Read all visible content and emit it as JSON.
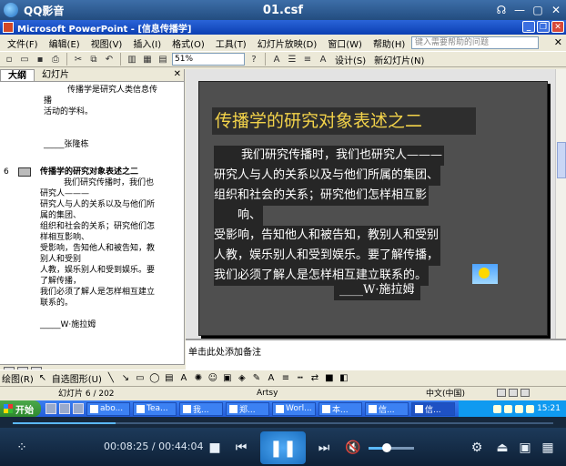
{
  "player": {
    "app_name": "QQ影音",
    "file_name": "01.csf",
    "win_buttons": [
      "☊",
      "—",
      "▢",
      "✕"
    ],
    "time_current": "00:08:25",
    "time_total": "00:44:04",
    "progress_fraction": 0.191,
    "volume_fraction": 0.4
  },
  "ppt": {
    "title": "Microsoft PowerPoint - [信息传播学]",
    "menu": [
      "文件(F)",
      "编辑(E)",
      "视图(V)",
      "插入(I)",
      "格式(O)",
      "工具(T)",
      "幻灯片放映(D)",
      "窗口(W)",
      "帮助(H)"
    ],
    "help_placeholder": "键入需要帮助的问题",
    "zoom": "51%",
    "design_label": "设计(S)",
    "new_slide_label": "新幻灯片(N)",
    "tabs": [
      "大纲",
      "幻灯片"
    ],
    "outline": {
      "pre_lines": [
        "传播学是研究人类信息传",
        "播",
        "活动的学科。"
      ],
      "pre_author": "_____张隆栋",
      "slide_number": "6",
      "slide_title": "传播学的研究对象表述之二",
      "body_lines": [
        "我们研究传播时，我们也",
        "研究人———",
        "研究人与人的关系以及与他们所",
        "属的集团、",
        "组织和社会的关系；研究他们怎",
        "样相互影响、",
        "受影响，告知他人和被告知，教",
        "别人和受别",
        "人教，娱乐别人和受到娱乐。要",
        "了解传播，",
        "我们必须了解人是怎样相互建立",
        "联系的。"
      ],
      "post_author": "_____W·施拉姆"
    },
    "slide": {
      "title": "传播学的研究对象表述之二",
      "lines": [
        "我们研究传播时，我们也研究人———",
        "研究人与人的关系以及与他们所属的集团、",
        "组织和社会的关系；研究他们怎样相互影",
        "响、",
        "受影响，告知他人和被告知，教别人和受别",
        "人教，娱乐别人和受到娱乐。要了解传播，",
        "我们必须了解人是怎样相互建立联系的。"
      ],
      "author": "____W·施拉姆"
    },
    "notes_placeholder": "单击此处添加备注",
    "draw_label": "绘图(R)",
    "autoshape_label": "自选图形(U)",
    "status": {
      "slide_count": "幻灯片 6 / 202",
      "design": "Artsy",
      "language": "中文(中国)"
    }
  },
  "taskbar": {
    "start": "开始",
    "tasks": [
      "abo...",
      "Tea...",
      "我...",
      "郑...",
      "Worl...",
      "本...",
      "信...",
      "信..."
    ],
    "clock": "15:21"
  }
}
